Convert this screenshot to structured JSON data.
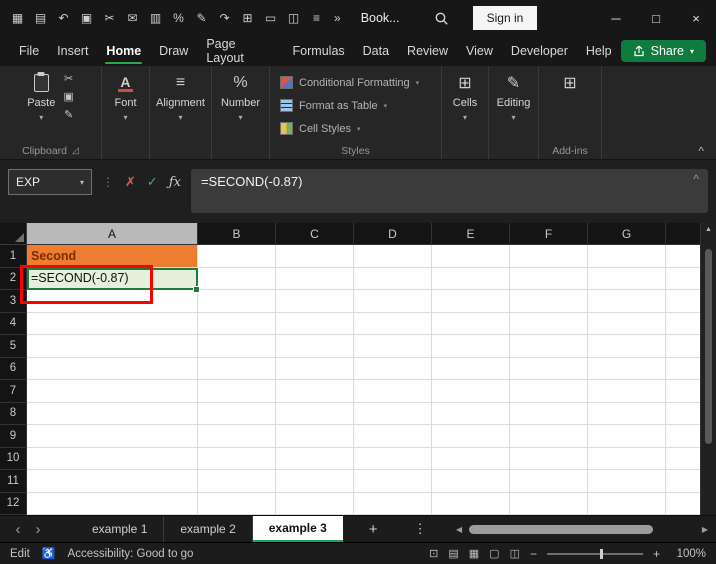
{
  "titlebar": {
    "qat_icons": [
      {
        "name": "app-menu-icon",
        "glyph": "▦"
      },
      {
        "name": "save-icon",
        "glyph": "▤"
      },
      {
        "name": "undo-icon",
        "glyph": "↶"
      },
      {
        "name": "copy-icon",
        "glyph": "▣"
      },
      {
        "name": "cut-icon",
        "glyph": "✂"
      },
      {
        "name": "mail-icon",
        "glyph": "✉"
      },
      {
        "name": "paste-icon",
        "glyph": "▥"
      },
      {
        "name": "percent-style-icon",
        "glyph": "%"
      },
      {
        "name": "format-painter-icon",
        "glyph": "✎"
      },
      {
        "name": "redo-icon",
        "glyph": "↷"
      },
      {
        "name": "insert-table-icon",
        "glyph": "⊞"
      },
      {
        "name": "window-icon",
        "glyph": "▭"
      },
      {
        "name": "camera-icon",
        "glyph": "◫"
      },
      {
        "name": "print-icon",
        "glyph": "≡"
      }
    ],
    "overflow_glyph": "»",
    "workbook_name": "Book...",
    "signin_label": "Sign in",
    "minimize_glyph": "─",
    "maximize_glyph": "□",
    "close_glyph": "×"
  },
  "menubar": {
    "items": [
      "File",
      "Insert",
      "Home",
      "Draw",
      "Page Layout",
      "Formulas",
      "Data",
      "Review",
      "View",
      "Developer",
      "Help"
    ],
    "active_item": "Home",
    "share_label": "Share"
  },
  "ribbon": {
    "paste_label": "Paste",
    "clipboard_icons": [
      {
        "name": "cut-icon",
        "glyph": "✂"
      },
      {
        "name": "copy-icon",
        "glyph": "▣"
      },
      {
        "name": "format-painter-icon",
        "glyph": "✎"
      }
    ],
    "collapsed_groups": [
      {
        "label": "Font",
        "icon": "A"
      },
      {
        "label": "Alignment",
        "icon": "≡"
      },
      {
        "label": "Number",
        "icon": "%"
      },
      {
        "label": "Cells",
        "icon": "⊞"
      },
      {
        "label": "Editing",
        "icon": "✎"
      }
    ],
    "styles_buttons": [
      "Conditional Formatting",
      "Format as Table",
      "Cell Styles"
    ],
    "addins_icon": "⊞",
    "group_labels": {
      "clipboard": "Clipboard",
      "styles": "Styles",
      "addins": "Add-ins"
    },
    "collapse_glyph": "^"
  },
  "formula_bar": {
    "name_box_value": "EXP",
    "cancel_glyph": "✗",
    "enter_glyph": "✓",
    "fx_label": "ƒx",
    "formula": "=SECOND(-0.87)",
    "expand_glyph": "^"
  },
  "grid": {
    "columns": [
      "A",
      "B",
      "C",
      "D",
      "E",
      "F",
      "G"
    ],
    "active_column": "A",
    "rows": [
      "1",
      "2",
      "3",
      "4",
      "5",
      "6",
      "7",
      "8",
      "9",
      "10",
      "11",
      "12"
    ],
    "cells": [
      {
        "ref": "A1",
        "text": "Second",
        "fill": "#ED7D31",
        "color": "#7C2D00",
        "bold": true
      },
      {
        "ref": "A2",
        "text": "=SECOND(-0.87)",
        "fill": "#E4F0DC",
        "color": "#111111",
        "bold": false
      }
    ]
  },
  "sheet_tabs": {
    "tabs": [
      {
        "label": "example 1",
        "active": false
      },
      {
        "label": "example 2",
        "active": false
      },
      {
        "label": "example 3",
        "active": true
      }
    ],
    "nav_left_glyph": "‹",
    "nav_right_glyph": "›",
    "add_glyph": "+",
    "menu_glyph": "⋮"
  },
  "status_bar": {
    "mode": "Edit",
    "accessibility_icon_glyph": "♿",
    "accessibility_text": "Accessibility: Good to go",
    "misc_icons": [
      {
        "name": "macro-record-icon",
        "glyph": "⊡"
      },
      {
        "name": "workbook-stats-icon",
        "glyph": "▤"
      }
    ],
    "view_icons": [
      {
        "name": "normal-view-icon",
        "glyph": "▦"
      },
      {
        "name": "page-layout-view-icon",
        "glyph": "▢"
      },
      {
        "name": "page-break-preview-icon",
        "glyph": "◫"
      }
    ],
    "zoom_out_glyph": "−",
    "zoom_in_glyph": "+",
    "zoom_label": "100%"
  },
  "colors": {
    "accent_green": "#107C41",
    "a1_fill": "#ED7D31",
    "a2_fill": "#E4F0DC",
    "annotation_red": "#FF0000",
    "selection_green": "#1E7B3C",
    "active_tab_underline": "#1F9E55"
  }
}
